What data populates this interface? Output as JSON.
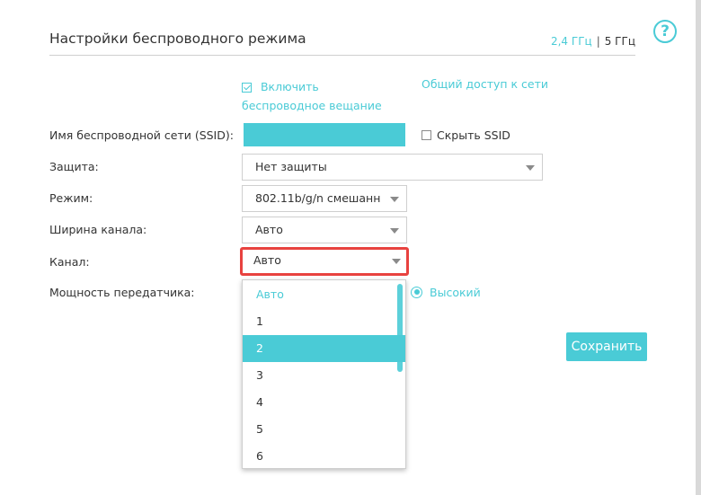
{
  "header": {
    "title": "Настройки беспроводного режима",
    "band_24": "2,4 ГГц",
    "band_sep": "|",
    "band_5": "5 ГГц",
    "help_glyph": "?"
  },
  "broadcast": {
    "label_line1": "Включить",
    "label_line2": "беспроводное вещание",
    "checked": true,
    "share_link": "Общий доступ к сети"
  },
  "form": {
    "ssid_label": "Имя беспроводной сети (SSID):",
    "ssid_value": "",
    "hide_ssid_label": "Скрыть SSID",
    "hide_ssid_checked": false,
    "security_label": "Защита:",
    "security_value": "Нет защиты",
    "mode_label": "Режим:",
    "mode_value": "802.11b/g/n смешанн",
    "width_label": "Ширина канала:",
    "width_value": "Авто",
    "channel_label": "Канал:",
    "channel_value": "Авто",
    "power_label": "Мощность передатчика:",
    "power_value": "Высокий"
  },
  "channel_dropdown": {
    "options": [
      "Авто",
      "1",
      "2",
      "3",
      "4",
      "5",
      "6"
    ],
    "highlighted": "2"
  },
  "actions": {
    "save_label": "Сохранить"
  },
  "colors": {
    "accent": "#4acbd6",
    "focus_border": "#e8423f"
  }
}
